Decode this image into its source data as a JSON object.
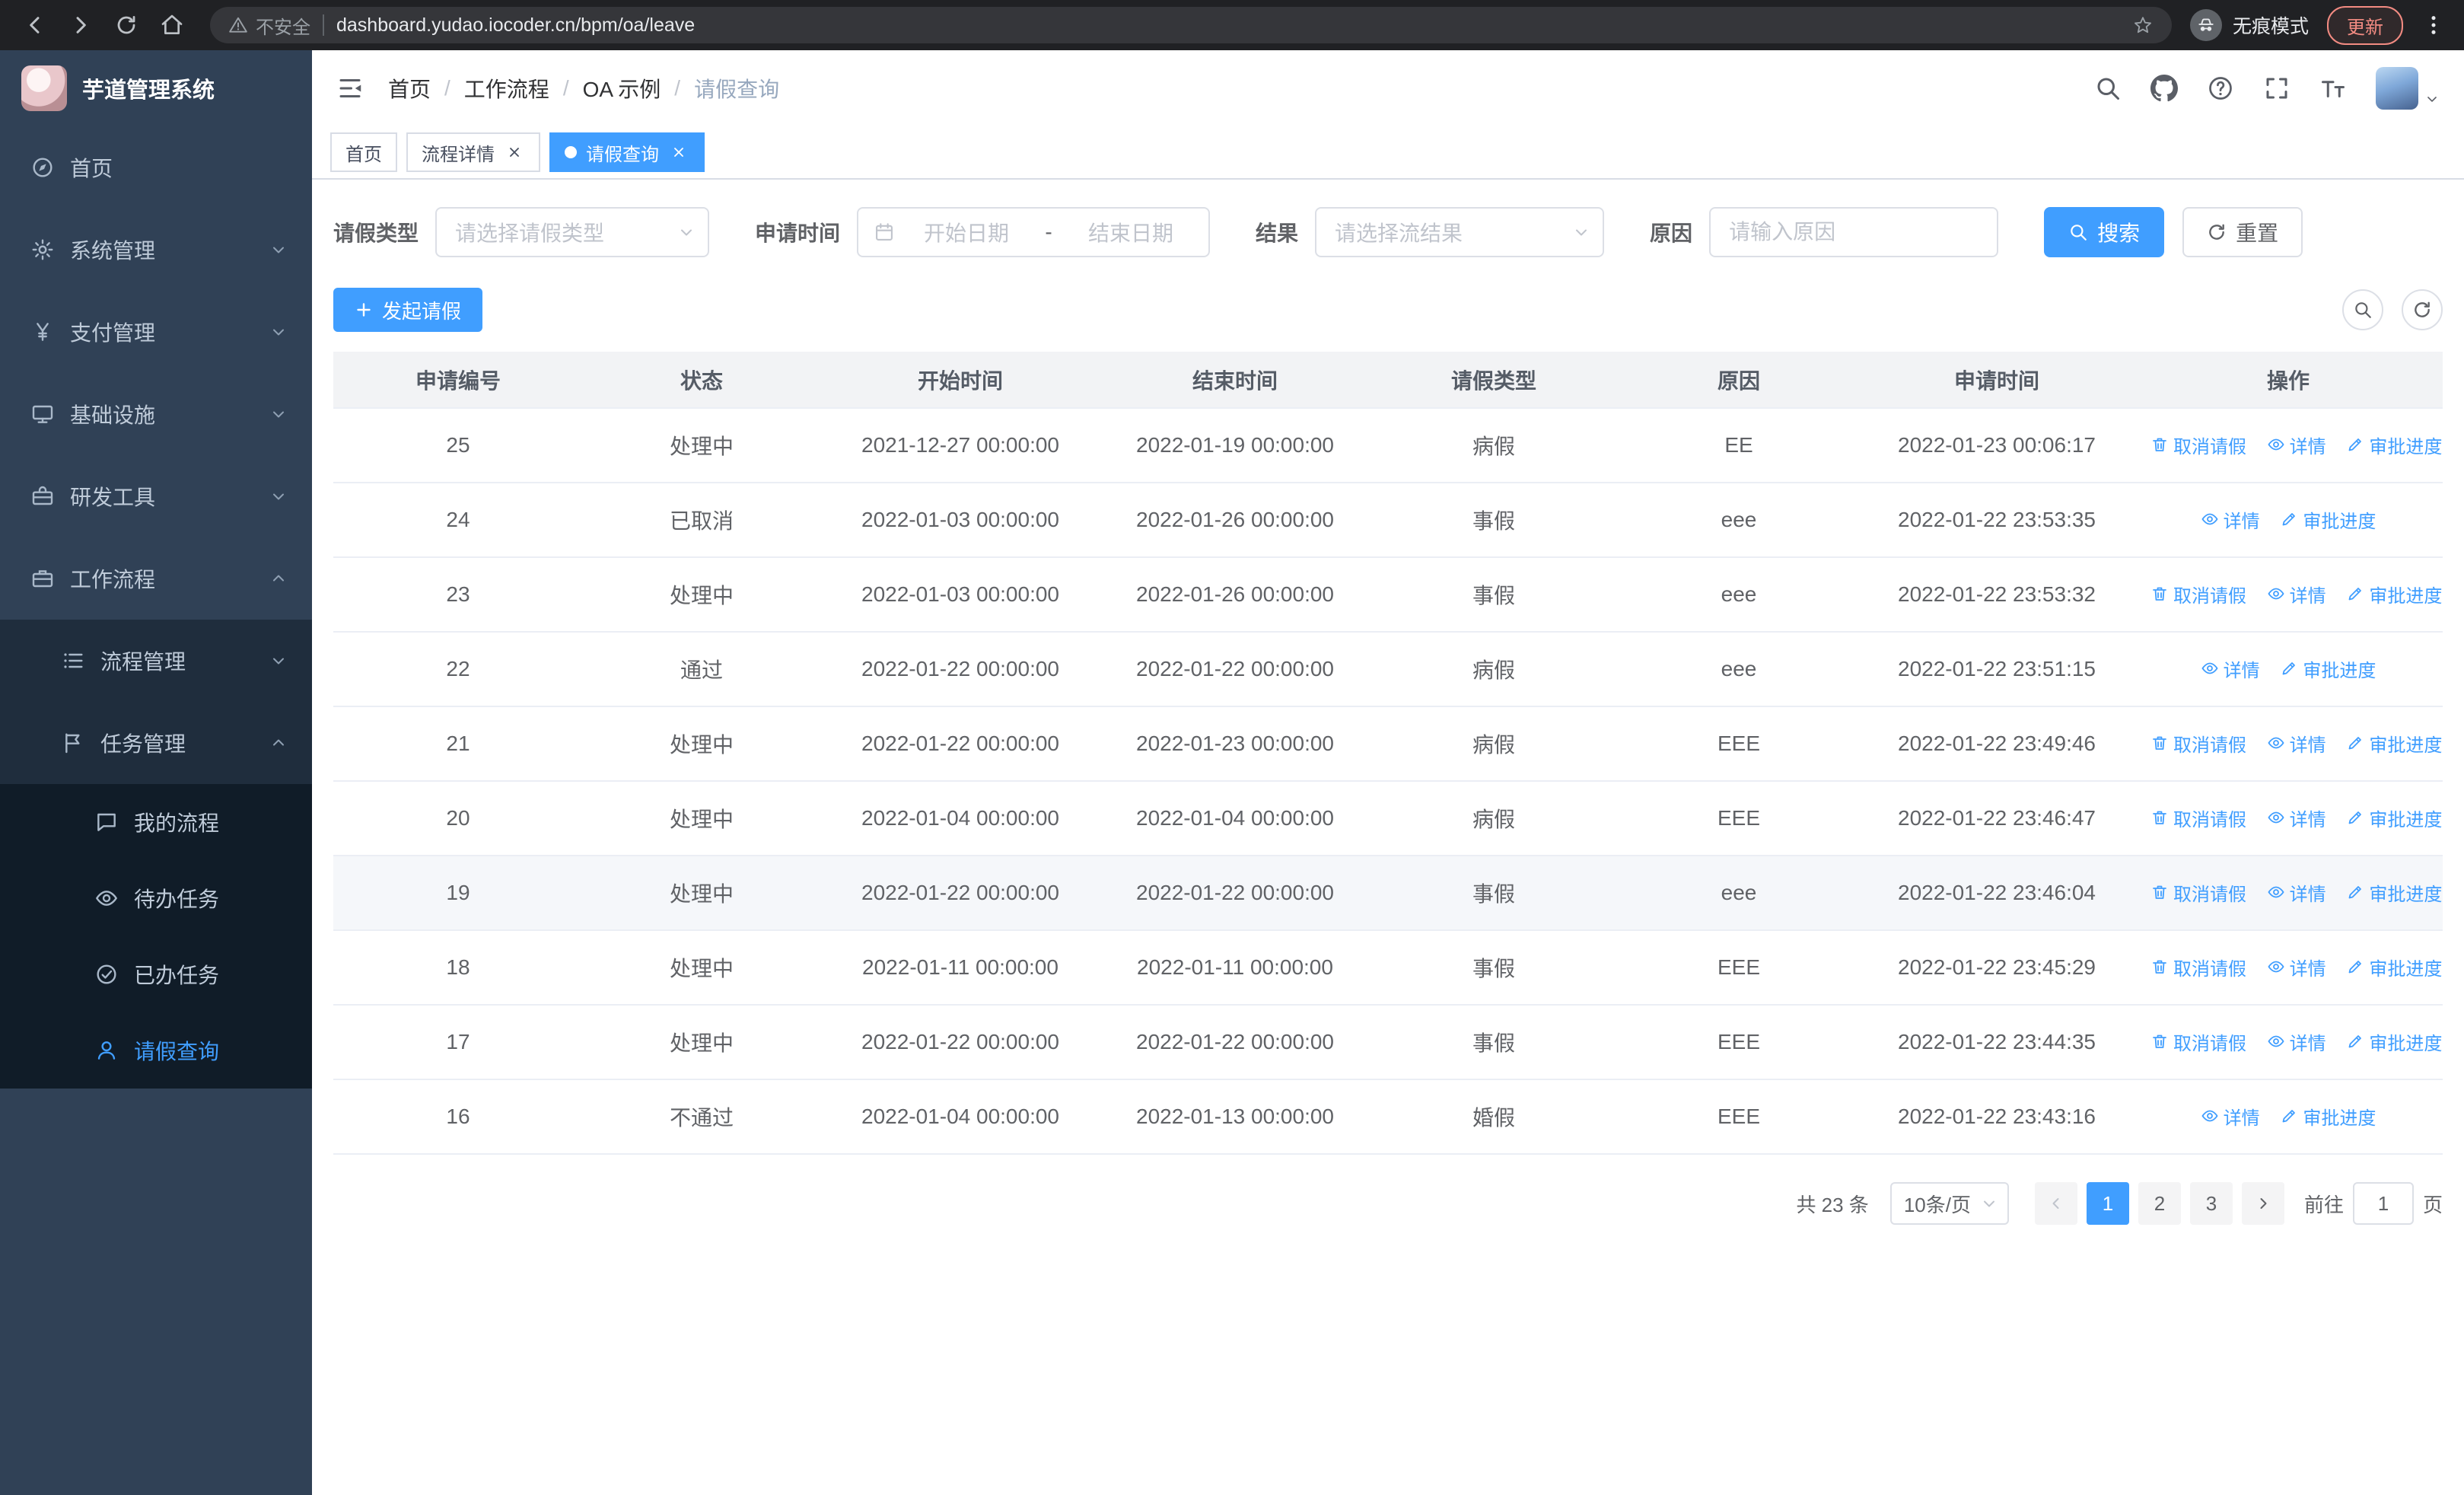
{
  "browser": {
    "security_warning": "不安全",
    "url": "dashboard.yudao.iocoder.cn/bpm/oa/leave",
    "incognito_label": "无痕模式",
    "update_label": "更新"
  },
  "sidebar": {
    "app_title": "芋道管理系统",
    "items": [
      {
        "label": "首页",
        "icon": "compass-icon",
        "level": 1
      },
      {
        "label": "系统管理",
        "icon": "gear-icon",
        "level": 1,
        "has_children": true
      },
      {
        "label": "支付管理",
        "icon": "yen-icon",
        "level": 1,
        "has_children": true
      },
      {
        "label": "基础设施",
        "icon": "monitor-icon",
        "level": 1,
        "has_children": true
      },
      {
        "label": "研发工具",
        "icon": "toolbox-icon",
        "level": 1,
        "has_children": true
      },
      {
        "label": "工作流程",
        "icon": "briefcase-icon",
        "level": 1,
        "has_children": true,
        "expanded": true
      },
      {
        "label": "流程管理",
        "icon": "list-icon",
        "level": 2,
        "has_children": true
      },
      {
        "label": "任务管理",
        "icon": "flag-icon",
        "level": 2,
        "has_children": true,
        "expanded": true
      },
      {
        "label": "我的流程",
        "icon": "chat-icon",
        "level": 3
      },
      {
        "label": "待办任务",
        "icon": "eye-icon",
        "level": 3
      },
      {
        "label": "已办任务",
        "icon": "check-circle-icon",
        "level": 3
      },
      {
        "label": "请假查询",
        "icon": "person-icon",
        "level": 3,
        "active": true
      }
    ]
  },
  "header": {
    "breadcrumb": [
      "首页",
      "工作流程",
      "OA 示例",
      "请假查询"
    ],
    "separator": "/"
  },
  "tabs": [
    {
      "label": "首页",
      "closable": false,
      "active": false
    },
    {
      "label": "流程详情",
      "closable": true,
      "active": false
    },
    {
      "label": "请假查询",
      "closable": true,
      "active": true
    }
  ],
  "filters": {
    "leave_type_label": "请假类型",
    "leave_type_placeholder": "请选择请假类型",
    "apply_time_label": "申请时间",
    "start_date_placeholder": "开始日期",
    "date_separator": "-",
    "end_date_placeholder": "结束日期",
    "result_label": "结果",
    "result_placeholder": "请选择流结果",
    "reason_label": "原因",
    "reason_placeholder": "请输入原因",
    "search_label": "搜索",
    "reset_label": "重置"
  },
  "toolbar": {
    "create_label": "发起请假"
  },
  "table": {
    "columns": [
      "申请编号",
      "状态",
      "开始时间",
      "结束时间",
      "请假类型",
      "原因",
      "申请时间",
      "操作"
    ],
    "actions": {
      "cancel": "取消请假",
      "detail": "详情",
      "progress": "审批进度"
    },
    "rows": [
      {
        "id": "25",
        "status": "处理中",
        "start": "2021-12-27 00:00:00",
        "end": "2022-01-19 00:00:00",
        "type": "病假",
        "reason": "EE",
        "applied": "2022-01-23 00:06:17",
        "can_cancel": true
      },
      {
        "id": "24",
        "status": "已取消",
        "start": "2022-01-03 00:00:00",
        "end": "2022-01-26 00:00:00",
        "type": "事假",
        "reason": "eee",
        "applied": "2022-01-22 23:53:35",
        "can_cancel": false
      },
      {
        "id": "23",
        "status": "处理中",
        "start": "2022-01-03 00:00:00",
        "end": "2022-01-26 00:00:00",
        "type": "事假",
        "reason": "eee",
        "applied": "2022-01-22 23:53:32",
        "can_cancel": true
      },
      {
        "id": "22",
        "status": "通过",
        "start": "2022-01-22 00:00:00",
        "end": "2022-01-22 00:00:00",
        "type": "病假",
        "reason": "eee",
        "applied": "2022-01-22 23:51:15",
        "can_cancel": false
      },
      {
        "id": "21",
        "status": "处理中",
        "start": "2022-01-22 00:00:00",
        "end": "2022-01-23 00:00:00",
        "type": "病假",
        "reason": "EEE",
        "applied": "2022-01-22 23:49:46",
        "can_cancel": true
      },
      {
        "id": "20",
        "status": "处理中",
        "start": "2022-01-04 00:00:00",
        "end": "2022-01-04 00:00:00",
        "type": "病假",
        "reason": "EEE",
        "applied": "2022-01-22 23:46:47",
        "can_cancel": true
      },
      {
        "id": "19",
        "status": "处理中",
        "start": "2022-01-22 00:00:00",
        "end": "2022-01-22 00:00:00",
        "type": "事假",
        "reason": "eee",
        "applied": "2022-01-22 23:46:04",
        "can_cancel": true,
        "highlighted": true
      },
      {
        "id": "18",
        "status": "处理中",
        "start": "2022-01-11 00:00:00",
        "end": "2022-01-11 00:00:00",
        "type": "事假",
        "reason": "EEE",
        "applied": "2022-01-22 23:45:29",
        "can_cancel": true
      },
      {
        "id": "17",
        "status": "处理中",
        "start": "2022-01-22 00:00:00",
        "end": "2022-01-22 00:00:00",
        "type": "事假",
        "reason": "EEE",
        "applied": "2022-01-22 23:44:35",
        "can_cancel": true
      },
      {
        "id": "16",
        "status": "不通过",
        "start": "2022-01-04 00:00:00",
        "end": "2022-01-13 00:00:00",
        "type": "婚假",
        "reason": "EEE",
        "applied": "2022-01-22 23:43:16",
        "can_cancel": false
      }
    ]
  },
  "pagination": {
    "total": "共 23 条",
    "page_size": "10条/页",
    "pages": [
      "1",
      "2",
      "3"
    ],
    "active_page": "1",
    "goto_label": "前往",
    "goto_value": "1",
    "goto_suffix": "页"
  },
  "colors": {
    "primary": "#409eff",
    "sidebar_bg": "#304156",
    "sidebar_submenu_bg": "#1f2d3d",
    "sidebar_deep_bg": "#101c28",
    "chrome_bg": "#202124",
    "update_red": "#f28b82",
    "table_header_bg": "#f2f3f5"
  }
}
